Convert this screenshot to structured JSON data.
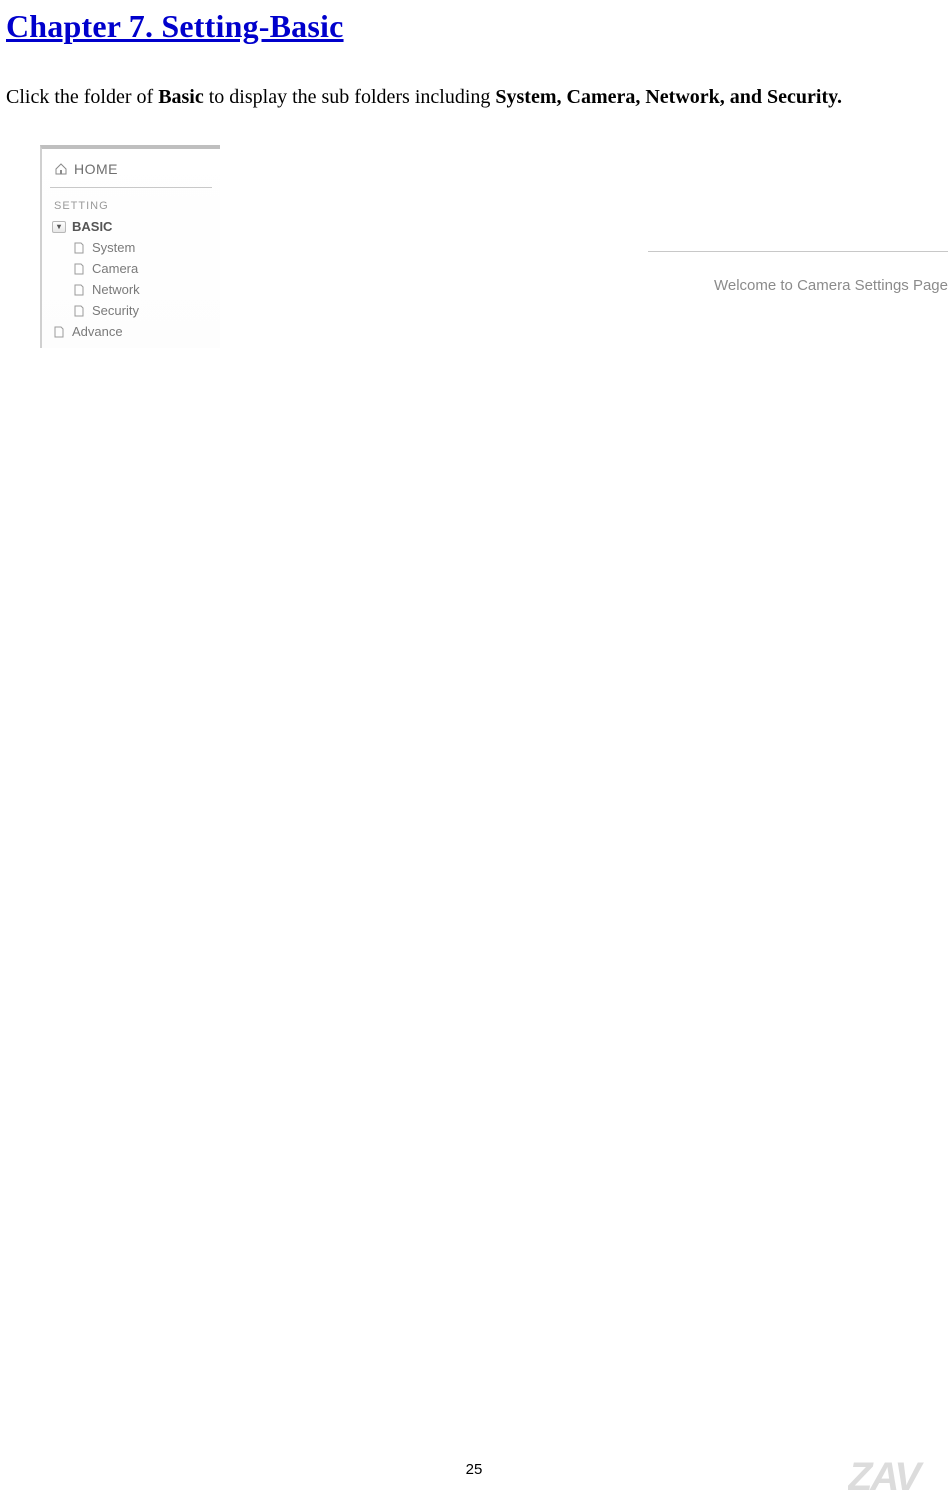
{
  "title": "Chapter 7. Setting-Basic  ",
  "intro": {
    "p1a": "Click the folder of ",
    "b1": "Basic",
    "p1b": " to display the sub folders including ",
    "b2": "System, Camera, Network, and Security."
  },
  "sidebar": {
    "home": "HOME",
    "section": "SETTING",
    "basic": "BASIC",
    "items": [
      "System",
      "Camera",
      "Network",
      "Security"
    ],
    "advance": "Advance"
  },
  "content": {
    "brand_faint": "",
    "welcome": "Welcome to Camera Settings Page"
  },
  "page_number": "25",
  "watermark": "ZAV"
}
